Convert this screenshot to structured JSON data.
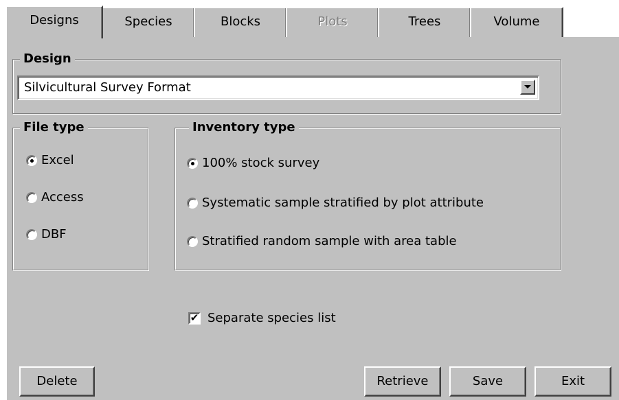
{
  "tabs": [
    {
      "label": "Designs",
      "active": true,
      "enabled": true
    },
    {
      "label": "Species",
      "active": false,
      "enabled": true
    },
    {
      "label": "Blocks",
      "active": false,
      "enabled": true
    },
    {
      "label": "Plots",
      "active": false,
      "enabled": false
    },
    {
      "label": "Trees",
      "active": false,
      "enabled": true
    },
    {
      "label": "Volume",
      "active": false,
      "enabled": true
    }
  ],
  "design": {
    "legend": "Design",
    "selected": "Silvicultural Survey Format"
  },
  "file_type": {
    "legend": "File type",
    "options": [
      {
        "label": "Excel",
        "checked": true
      },
      {
        "label": "Access",
        "checked": false
      },
      {
        "label": "DBF",
        "checked": false
      }
    ]
  },
  "inventory_type": {
    "legend": "Inventory type",
    "options": [
      {
        "label": "100% stock survey",
        "checked": true
      },
      {
        "label": "Systematic sample stratified by plot attribute",
        "checked": false
      },
      {
        "label": "Stratified random sample with area table",
        "checked": false
      }
    ]
  },
  "separate_species": {
    "label": "Separate species list",
    "checked": true,
    "mark": "✔"
  },
  "buttons": {
    "delete": "Delete",
    "retrieve": "Retrieve",
    "save": "Save",
    "exit": "Exit"
  }
}
